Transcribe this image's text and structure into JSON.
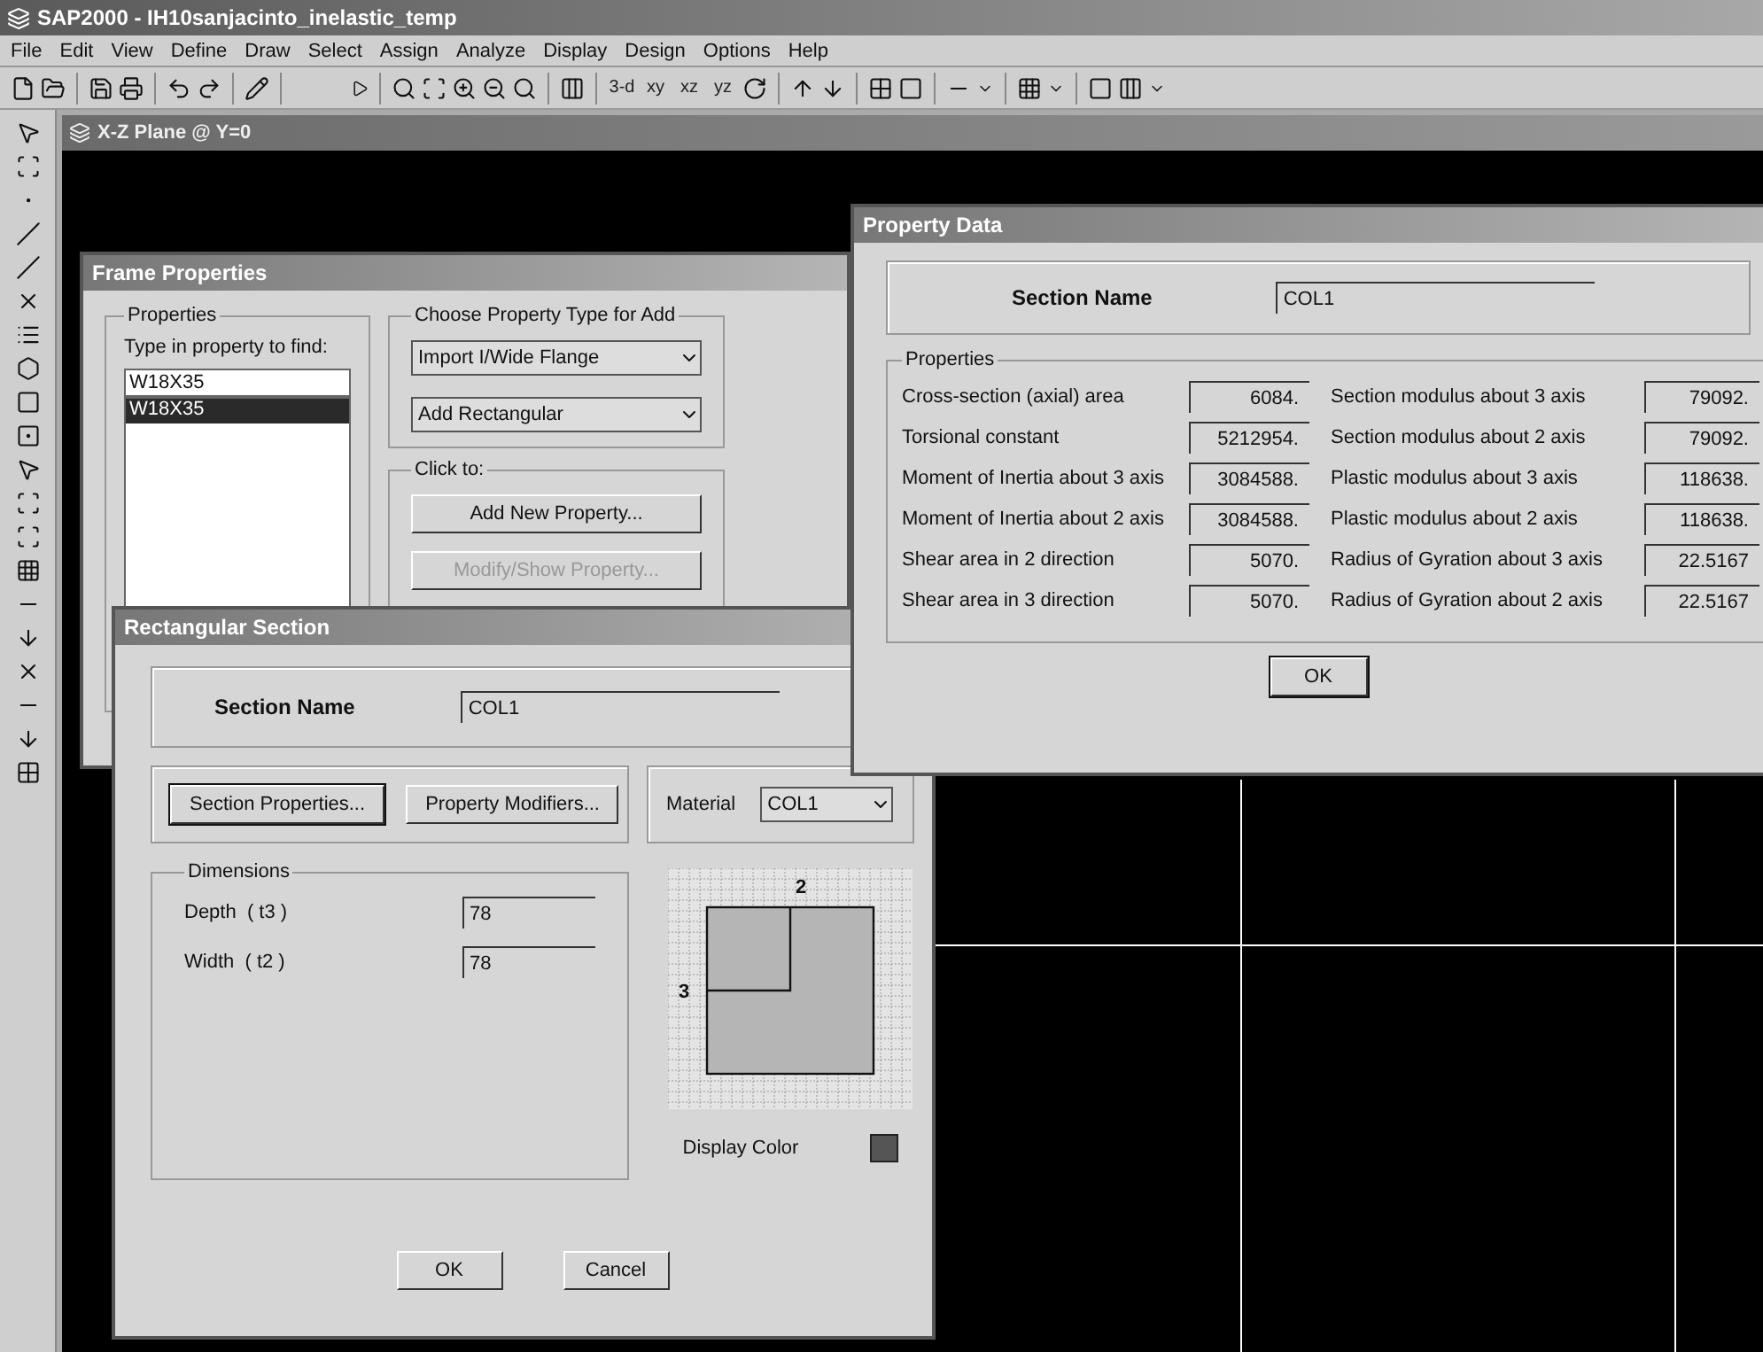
{
  "window": {
    "title": "SAP2000 - IH10sanjacinto_inelastic_temp"
  },
  "menu": [
    "File",
    "Edit",
    "View",
    "Define",
    "Draw",
    "Select",
    "Assign",
    "Analyze",
    "Display",
    "Design",
    "Options",
    "Help"
  ],
  "toolbar": {
    "view_buttons": [
      "3-d",
      "xy",
      "xz",
      "yz"
    ]
  },
  "child_window": {
    "title": "X-Z Plane @ Y=0"
  },
  "frame_properties": {
    "title": "Frame Properties",
    "properties_group": {
      "legend": "Properties",
      "find_label": "Type in property to find:",
      "find_value": "W18X35",
      "items": [
        {
          "label": "W18X35",
          "selected": true
        }
      ]
    },
    "type_group": {
      "legend": "Choose Property Type for Add",
      "dropdowns": [
        "Import I/Wide Flange",
        "Add Rectangular"
      ]
    },
    "click_group": {
      "legend": "Click to:",
      "buttons": [
        {
          "label": "Add New Property...",
          "disabled": false
        },
        {
          "label": "Modify/Show Property...",
          "disabled": true
        }
      ]
    }
  },
  "rectangular_section": {
    "title": "Rectangular Section",
    "section_name_label": "Section Name",
    "section_name": "COL1",
    "buttons": [
      "Section Properties...",
      "Property Modifiers..."
    ],
    "material_label": "Material",
    "material": "COL1",
    "dimensions": {
      "legend": "Dimensions",
      "fields": [
        {
          "label": "Depth  ( t3 )",
          "value": "78"
        },
        {
          "label": "Width  ( t2 )",
          "value": "78"
        }
      ]
    },
    "axis_labels": [
      "2",
      "3"
    ],
    "display_color_label": "Display Color",
    "display_swatch": {
      "color": "#555555"
    },
    "actions": [
      "OK",
      "Cancel"
    ]
  },
  "property_data": {
    "title": "Property Data",
    "section_name_label": "Section Name",
    "section_name": "COL1",
    "legend": "Properties",
    "properties": [
      {
        "label": "Cross-section (axial) area",
        "value": "6084."
      },
      {
        "label": "Section modulus about 3 axis",
        "value": "79092."
      },
      {
        "label": "Torsional constant",
        "value": "5212954."
      },
      {
        "label": "Section modulus about 2 axis",
        "value": "79092."
      },
      {
        "label": "Moment of Inertia about 3 axis",
        "value": "3084588."
      },
      {
        "label": "Plastic modulus about 3 axis",
        "value": "118638."
      },
      {
        "label": "Moment of Inertia about 2 axis",
        "value": "3084588."
      },
      {
        "label": "Plastic modulus about 2 axis",
        "value": "118638."
      },
      {
        "label": "Shear area in 2 direction",
        "value": "5070."
      },
      {
        "label": "Radius of Gyration about 3 axis",
        "value": "22.5167"
      },
      {
        "label": "Shear area in 3 direction",
        "value": "5070."
      },
      {
        "label": "Radius of Gyration about 2 axis",
        "value": "22.5167"
      }
    ],
    "ok": "OK"
  }
}
